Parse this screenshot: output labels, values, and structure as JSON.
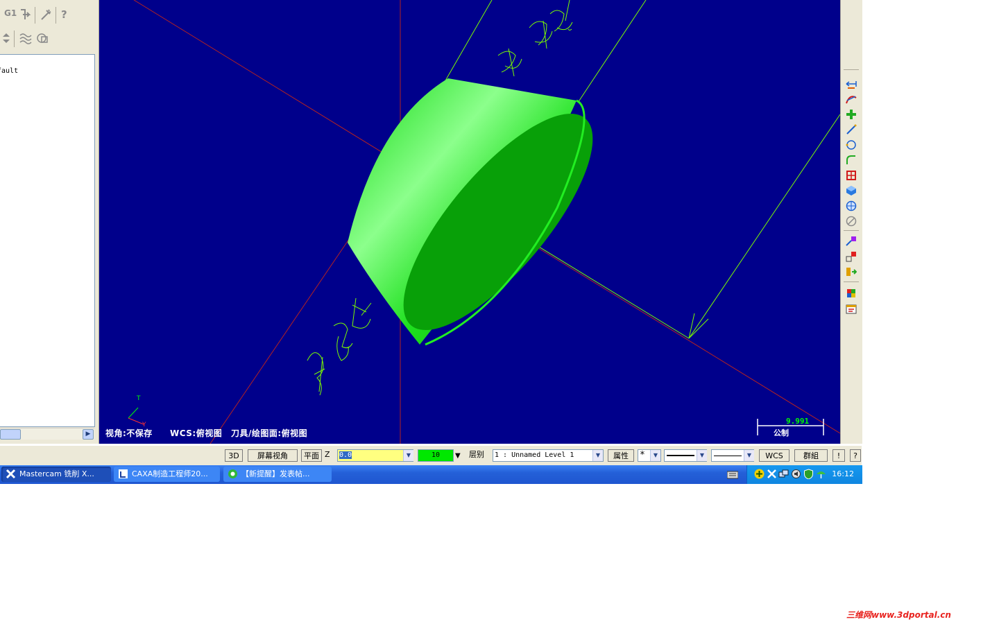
{
  "left_panel": {
    "toolbar_row1": {
      "g1_label": "G1",
      "help_label": "?"
    },
    "tree_item": "fault"
  },
  "viewport": {
    "axis_label_top": "T",
    "axis_label_bottom": "Y",
    "status_view": "视角:不保存",
    "status_wcs": "WCS:俯视图",
    "status_tool_plane": "刀具/绘图面:俯视图",
    "scale_value": "9.991",
    "scale_unit": "公制",
    "background_color": "#00008b",
    "solid_color": "#00e800",
    "wire_color": "#7cfc00",
    "axis_color": "#b22222"
  },
  "status_bar": {
    "btn_3d": "3D",
    "btn_screen_view": "屏幕视角",
    "btn_plane": "平面",
    "z_label": "Z",
    "z_value": "0.0",
    "color_value": "10",
    "level_label": "层别",
    "level_value": "1 : Unnamed Level 1",
    "btn_attributes": "属性",
    "point_style": "*",
    "btn_wcs": "WCS",
    "btn_group": "群組",
    "btn_alert": "!",
    "btn_help": "?"
  },
  "taskbar": {
    "tasks": [
      {
        "label": "Mastercam 铣削 X..."
      },
      {
        "label": "CAXA制造工程师20..."
      },
      {
        "label": "【新提醒】发表帖..."
      }
    ],
    "clock": "16:12"
  },
  "watermark": "三维网www.3dportal.cn"
}
